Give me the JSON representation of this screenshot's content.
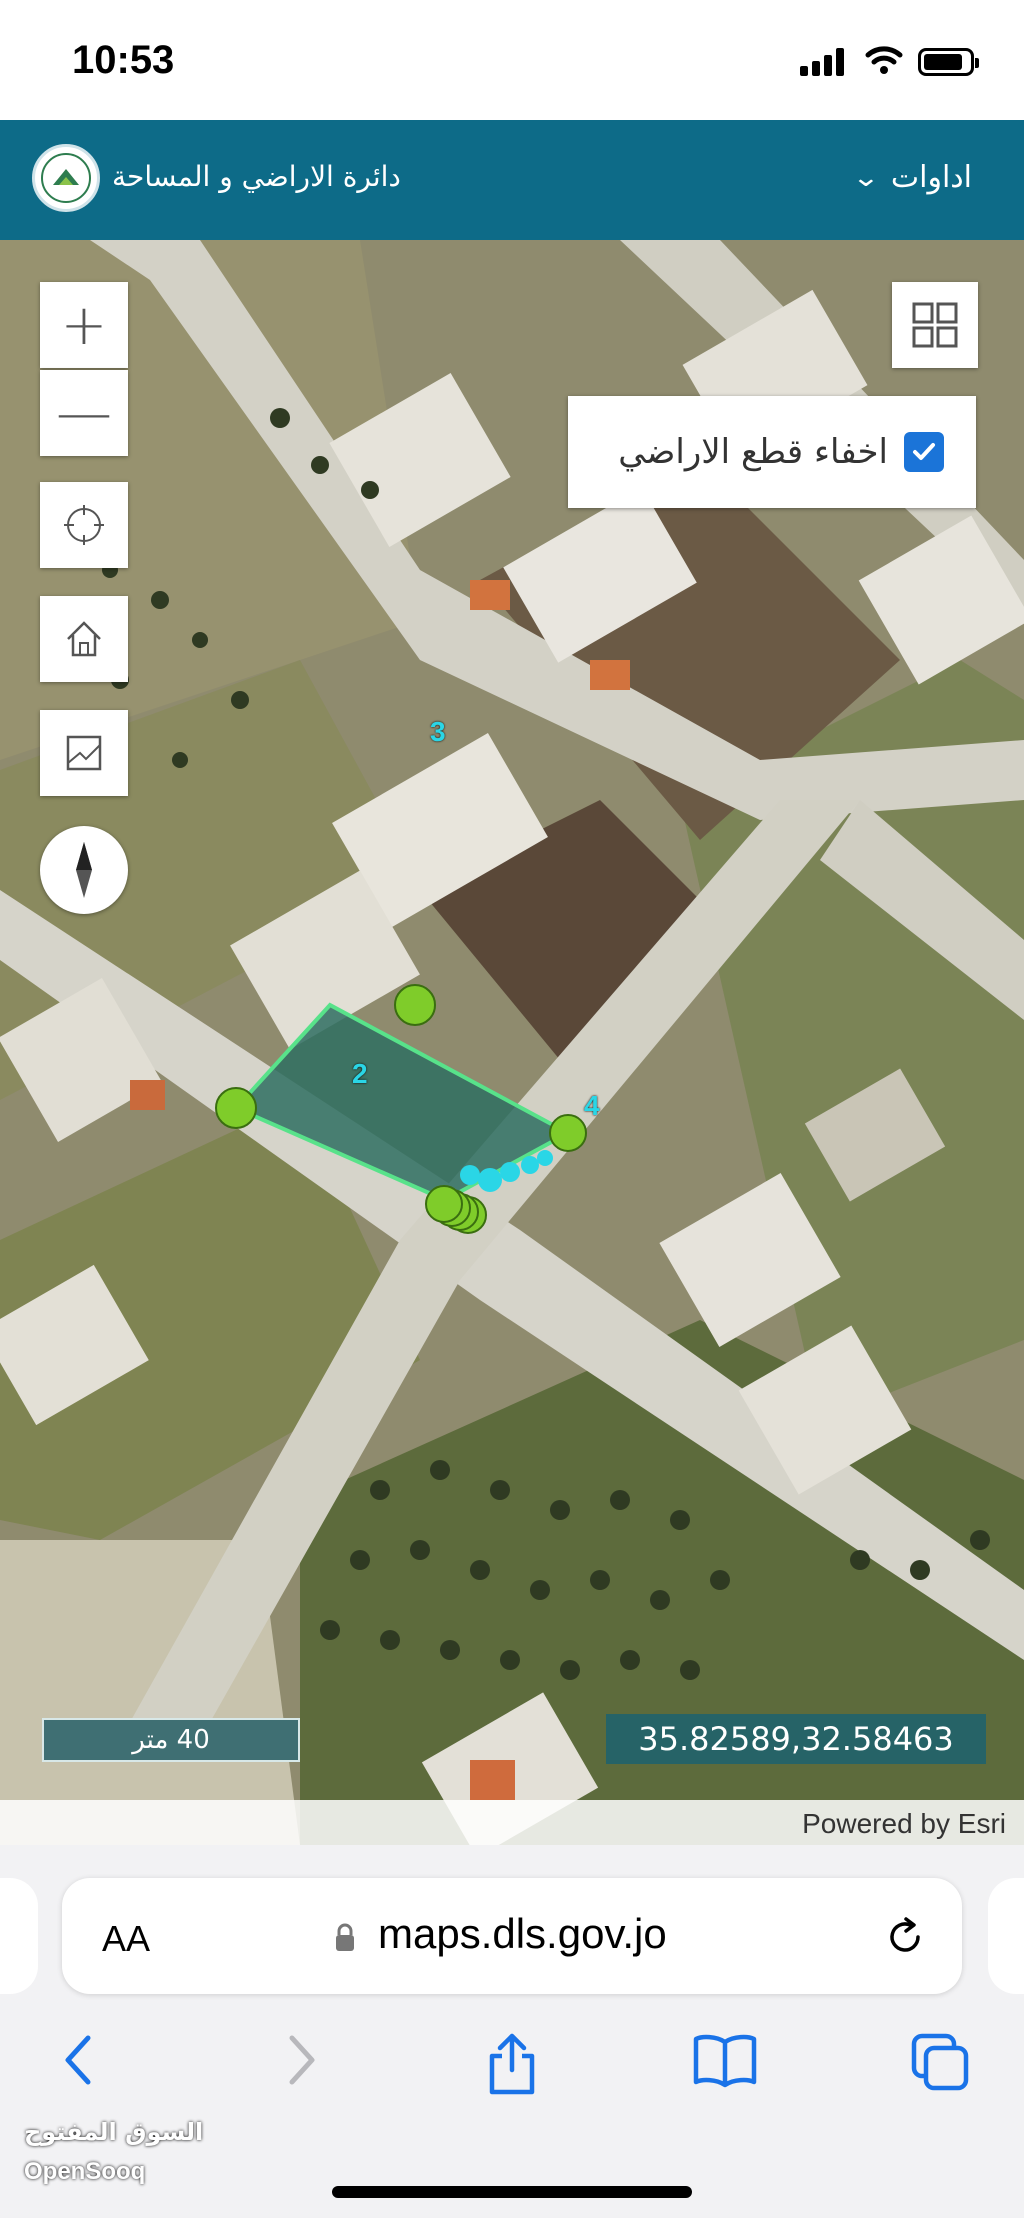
{
  "status_bar": {
    "time": "10:53"
  },
  "header": {
    "title": "دائرة الاراضي و المساحة",
    "tools_label": "اداوات"
  },
  "map": {
    "zoom_in": "+",
    "zoom_out": "—",
    "layer_toggle_label": "اخفاء قطع الاراضي",
    "layer_toggle_checked": true,
    "scale_label": "40 متر",
    "coordinates": "35.82589,32.58463",
    "attribution": "Powered by Esri",
    "vertex_labels": [
      "2",
      "3",
      "4"
    ],
    "parcel_color": "#58e28a"
  },
  "browser": {
    "aa_label": "AA",
    "url": "maps.dls.gov.jo"
  },
  "watermark": {
    "arabic": "السوق المفتوح",
    "latin": "OpenSooq"
  }
}
